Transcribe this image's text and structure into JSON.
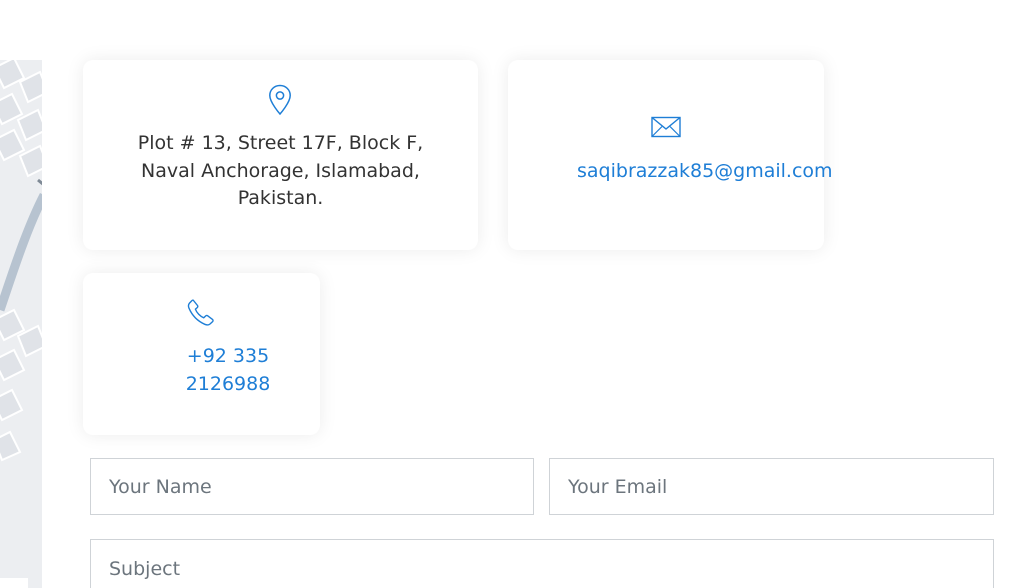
{
  "contact": {
    "address": {
      "icon": "map-pin-icon",
      "line1": "Plot # 13, Street 17F, Block F,",
      "line2": "Naval Anchorage, Islamabad,",
      "line3": "Pakistan."
    },
    "email": {
      "icon": "envelope-icon",
      "address": "saqibrazzak85@gmail.com"
    },
    "phone": {
      "icon": "phone-icon",
      "line1": "+92 335",
      "line2": "2126988"
    }
  },
  "form": {
    "name_placeholder": "Your Name",
    "email_placeholder": "Your Email",
    "subject_placeholder": "Subject"
  },
  "colors": {
    "accent": "#1e7ed6",
    "text": "#333333",
    "border": "#cfd3d7"
  }
}
